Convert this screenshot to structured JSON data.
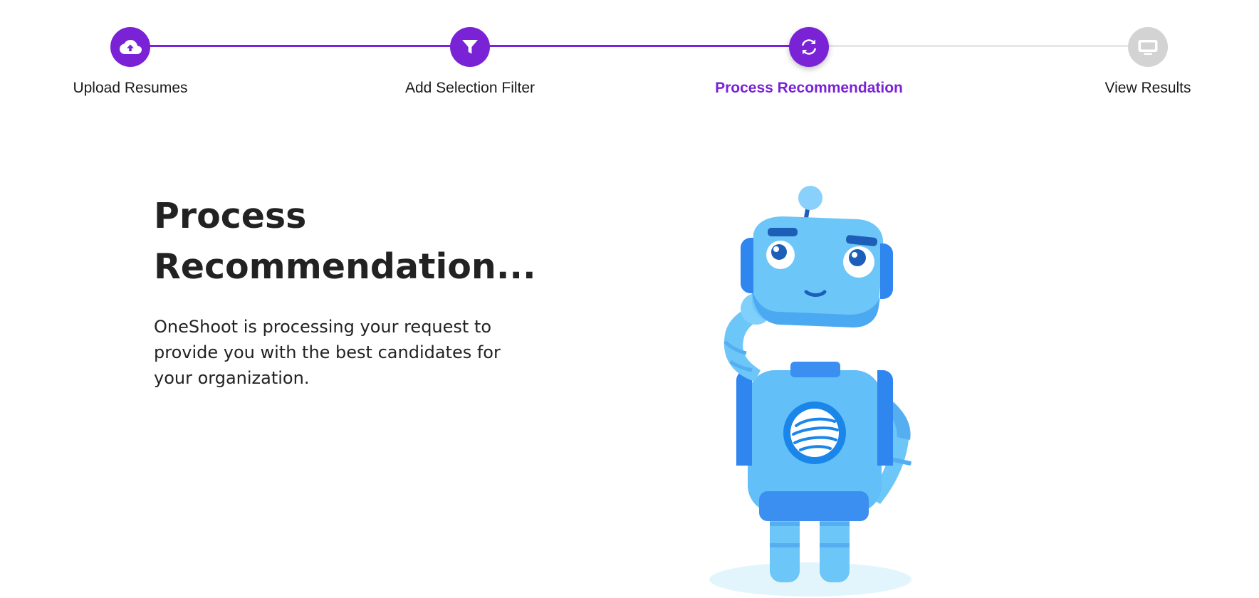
{
  "stepper": {
    "steps": [
      {
        "label": "Upload Resumes",
        "state": "done",
        "icon": "cloud-upload-icon"
      },
      {
        "label": "Add Selection Filter",
        "state": "done",
        "icon": "filter-icon"
      },
      {
        "label": "Process Recommendation",
        "state": "current",
        "icon": "sync-icon"
      },
      {
        "label": "View Results",
        "state": "pending",
        "icon": "monitor-icon"
      }
    ],
    "accent_color": "#7a22d6",
    "pending_color": "#d3d3d3"
  },
  "main": {
    "title": "Process Recommendation...",
    "description": "OneShoot is processing your request to provide you with the best candidates for your organization.",
    "illustration": "thinking-robot-illustration"
  }
}
